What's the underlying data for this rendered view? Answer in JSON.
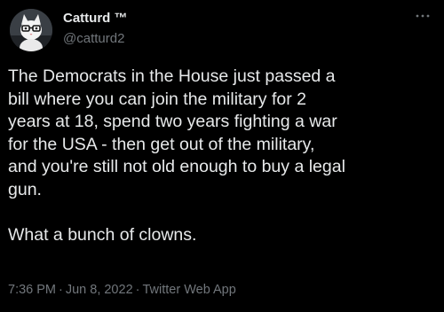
{
  "author": {
    "display_name": "Catturd ™",
    "handle": "@catturd2"
  },
  "menu": {
    "icon": "more-horizontal-icon",
    "glyph": "···"
  },
  "tweet": {
    "text": "The Democrats in the House just passed a\nbill where you can join the military for 2\nyears at 18, spend two years fighting a war\nfor the USA - then get out of the military,\nand you're still not old enough to buy a legal\ngun.\n\nWhat a bunch of clowns.",
    "time": "7:36 PM",
    "date": "Jun 8, 2022",
    "source": "Twitter Web App",
    "separator": "·"
  },
  "colors": {
    "background": "#000000",
    "text": "#e7e9ea",
    "secondary": "#71767b"
  }
}
